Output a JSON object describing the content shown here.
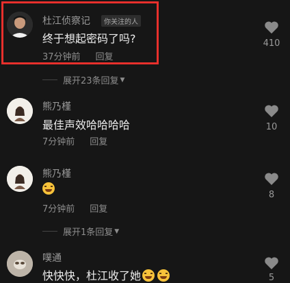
{
  "comments": [
    {
      "user": "杜江侦察记",
      "tag": "你关注的人",
      "text": "终于想起密码了吗?",
      "time": "37分钟前",
      "reply": "回复",
      "likes": "410"
    },
    {
      "user": "熊乃槿",
      "text": "最佳声效哈哈哈哈",
      "time": "7分钟前",
      "reply": "回复",
      "likes": "10"
    },
    {
      "user": "熊乃槿",
      "text": "",
      "time": "7分钟前",
      "reply": "回复",
      "likes": "8"
    },
    {
      "user": "噗通",
      "text": "快快快，杜江收了她",
      "likes": "5"
    }
  ],
  "expand_1": "展开23条回复",
  "expand_2": "展开1条回复",
  "colors": {
    "highlight": "#e8302c",
    "background": "#161616"
  },
  "icons": {
    "like": "heart-icon",
    "expand": "caret-down-icon",
    "emoji": "laughing-crying-emoji"
  }
}
